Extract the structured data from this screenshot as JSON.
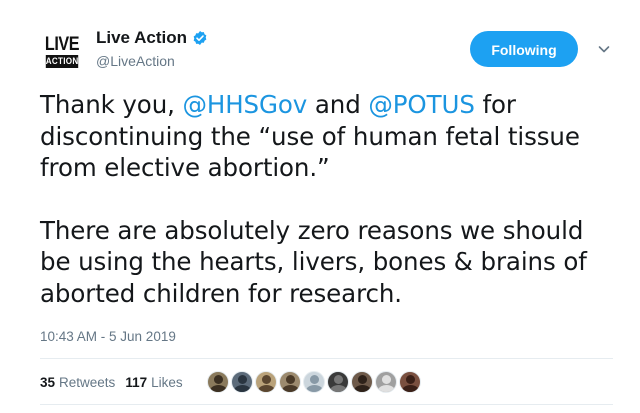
{
  "header": {
    "logo_top": "LIVE",
    "logo_bottom": "ACTION",
    "display_name": "Live Action",
    "handle": "@LiveAction",
    "follow_label": "Following",
    "verified_icon": "verified-badge-icon",
    "caret_icon": "chevron-down-icon"
  },
  "tweet": {
    "p1_pre": "Thank you, ",
    "mention1": "@HHSGov",
    "p1_mid": " and ",
    "mention2": "@POTUS",
    "p1_post": " for discontinuing the “use of human fetal tissue from elective abortion.”",
    "p2": "There are absolutely zero reasons we should be using the hearts, livers, bones & brains of aborted children for research.",
    "timestamp": "10:43 AM - 5 Jun 2019"
  },
  "stats": {
    "retweets_count": "35",
    "retweets_label": "Retweets",
    "likes_count": "117",
    "likes_label": "Likes"
  },
  "colors": {
    "accent": "#1da1f2",
    "link": "#1b95e0",
    "text": "#14171a",
    "muted": "#657786"
  },
  "avatars": [
    {
      "bg": "#8a7a5c",
      "fg": "#3b3022"
    },
    {
      "bg": "#5c6b7a",
      "fg": "#2a3540"
    },
    {
      "bg": "#b9a27a",
      "fg": "#5a4630"
    },
    {
      "bg": "#9c8a6e",
      "fg": "#4a3a28"
    },
    {
      "bg": "#ccd6dd",
      "fg": "#8899a6"
    },
    {
      "bg": "#3a3a3a",
      "fg": "#777777"
    },
    {
      "bg": "#6e5a4a",
      "fg": "#2e221a"
    },
    {
      "bg": "#a0a0a0",
      "fg": "#e0e0e0"
    },
    {
      "bg": "#7a5040",
      "fg": "#3a2018"
    }
  ]
}
